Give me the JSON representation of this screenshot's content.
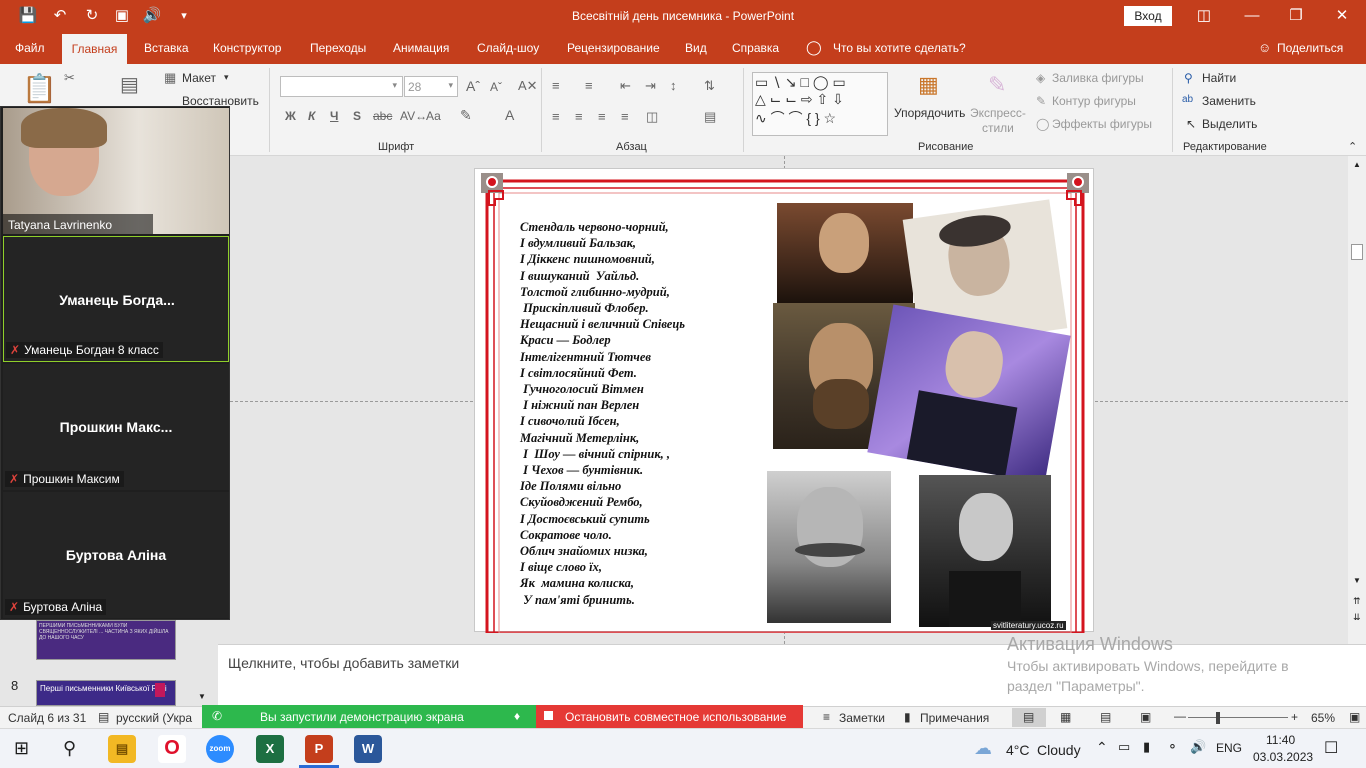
{
  "titlebar": {
    "title": "Всесвітній день писемника - PowerPoint",
    "login": "Вход",
    "qat": {
      "save": "save-icon",
      "undo": "undo-icon",
      "redo": "redo-icon",
      "present": "present-icon",
      "audio": "audio-icon",
      "customize": "chevron-down-icon"
    }
  },
  "tabs": [
    "Файл",
    "Главная",
    "Вставка",
    "Конструктор",
    "Переходы",
    "Анимация",
    "Слайд-шоу",
    "Рецензирование",
    "Вид",
    "Справка"
  ],
  "tell_me": "Что вы хотите сделать?",
  "share": "Поделиться",
  "ribbon": {
    "slides": {
      "layout": "Макет",
      "reset": "Восстановить"
    },
    "font": {
      "label": "Шрифт",
      "size": "28",
      "bold": "Ж",
      "italic": "К",
      "underline": "Ч",
      "strike": "S",
      "spacing": "abc",
      "case": "Аа",
      "color": "A"
    },
    "paragraph": {
      "label": "Абзац"
    },
    "drawing": {
      "label": "Рисование",
      "arrange": "Упорядочить",
      "quick_styles": "Экспресс-\nстили",
      "fill": "Заливка фигуры",
      "outline": "Контур фигуры",
      "effects": "Эффекты фигуры"
    },
    "editing": {
      "label": "Редактирование",
      "find": "Найти",
      "replace": "Заменить",
      "select": "Выделить"
    }
  },
  "slide": {
    "poem": [
      "Стендаль червоно-чорний,",
      "І вдумливий Бальзак,",
      "І Діккенс пишномовний,",
      "І вишуканий  Уайльд.",
      "Толстой глибинно-мудрий,",
      " Прискіпливий Флобер.",
      "Нещасний і величний Співець",
      "Краси — Бодлер",
      "Інтелігентний Тютчев",
      "І світлосяйний Фет.",
      " Гучноголосий Вітмен",
      " І ніжний пан Верлен",
      "І сивочолий Ібсен,",
      "Магічний Метерлінк,",
      " І  Шоу — вічний спірник, ,",
      " І Чехов — бунтівник.",
      "Іде Полями вільно",
      "Скуйовджений Рембо,",
      "І Достоєвський супить",
      "Сократове чоло.",
      "Облич знайомих низка,",
      "І віще слово їх,",
      "Як  мамина колиска,",
      " У пам'яті бринить."
    ],
    "watermark": "svitliteratury.ucoz.ru"
  },
  "notes": {
    "placeholder": "Щелкните, чтобы добавить заметки"
  },
  "activation": {
    "title": "Активация Windows",
    "line1": "Чтобы активировать Windows, перейдите в",
    "line2": "раздел \"Параметры\"."
  },
  "thumbnails": [
    {
      "number": "8",
      "text": "Перші письменники Київської Русі"
    }
  ],
  "thumb7_text": "ПЕРШИМИ ПИСЬМЕННИКАМИ БУЛИ СВЯЩЕННОСЛУЖИТЕЛІ ... ЧАСТИНА З ЯКИХ ДІЙШЛА ДО НАШОГО ЧАСУ",
  "zoom": {
    "tiles": [
      {
        "label": "Tatyana Lavrinenko",
        "display": "",
        "video": true
      },
      {
        "label": "Уманець Богдан 8 класс",
        "display": "Уманець  Богда...",
        "video": false
      },
      {
        "label": "Прошкин Максим",
        "display": "Прошкин  Макс...",
        "video": false
      },
      {
        "label": "Буртова Аліна",
        "display": "Буртова Аліна",
        "video": false
      }
    ],
    "share_status": "Вы запустили демонстрацию экрана",
    "stop": "Остановить совместное использование"
  },
  "status": {
    "slide": "Слайд 6 из 31",
    "language": "русский (Укра",
    "notes": "Заметки",
    "comments": "Примечания",
    "zoom": "65%"
  },
  "taskbar": {
    "weather_temp": "4°C",
    "weather_desc": "Cloudy",
    "lang": "ENG",
    "time": "11:40",
    "date": "03.03.2023"
  }
}
